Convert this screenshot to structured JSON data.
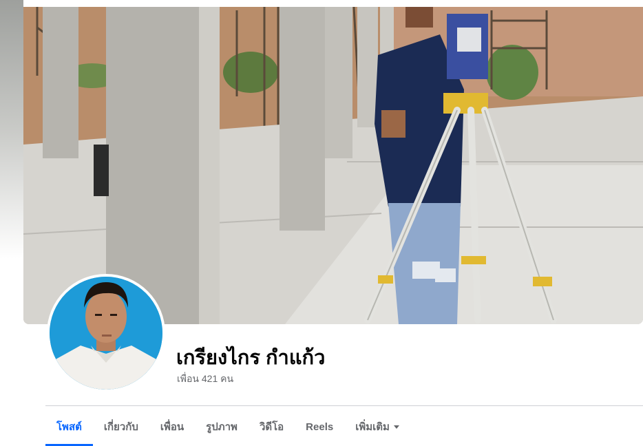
{
  "profile": {
    "name": "เกรียงไกร กำแก้ว",
    "friends_text": "เพื่อน 421 คน"
  },
  "tabs": [
    {
      "label": "โพสต์",
      "active": true
    },
    {
      "label": "เกี่ยวกับ",
      "active": false
    },
    {
      "label": "เพื่อน",
      "active": false
    },
    {
      "label": "รูปภาพ",
      "active": false
    },
    {
      "label": "วิดีโอ",
      "active": false
    },
    {
      "label": "Reels",
      "active": false
    },
    {
      "label": "เพิ่มเติม",
      "active": false,
      "icon": "caret-down-icon"
    }
  ],
  "colors": {
    "accent": "#0866ff",
    "text_primary": "#050505",
    "text_secondary": "#65676b",
    "divider": "#ced0d4"
  }
}
